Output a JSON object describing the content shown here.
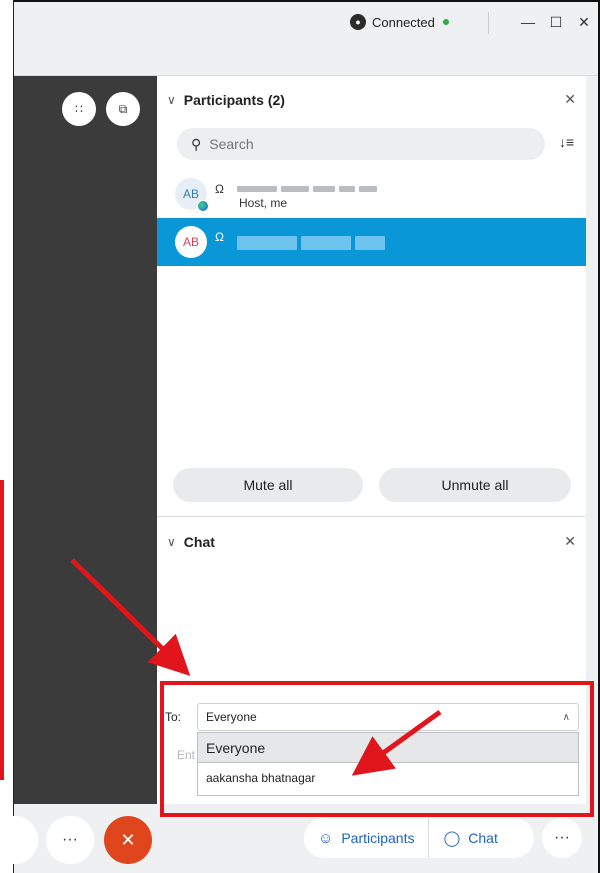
{
  "titlebar": {
    "status": "Connected",
    "status_color": "#2fa84f",
    "minimize_icon": "minimize-icon",
    "maximize_icon": "maximize-icon",
    "close_icon": "close-icon"
  },
  "participants": {
    "header": "Participants (2)",
    "search_placeholder": "Search",
    "list": [
      {
        "initials": "AB",
        "sub": "Host, me",
        "selected": false
      },
      {
        "initials": "AB",
        "sub": "",
        "selected": true
      }
    ],
    "mute_all": "Mute all",
    "unmute_all": "Unmute all"
  },
  "chat": {
    "header": "Chat",
    "to_label": "To:",
    "to_value": "Everyone",
    "input_hint": "Ent",
    "dropdown_options": [
      "Everyone",
      "aakansha bhatnagar"
    ]
  },
  "bottombar": {
    "more_label": "···",
    "participants_label": "Participants",
    "chat_label": "Chat",
    "overflow_label": "···",
    "end_label": "✕"
  },
  "colors": {
    "accent": "#0a97d8",
    "annotation": "#e0161c",
    "link": "#1a64c8",
    "end_call": "#e0461e"
  }
}
